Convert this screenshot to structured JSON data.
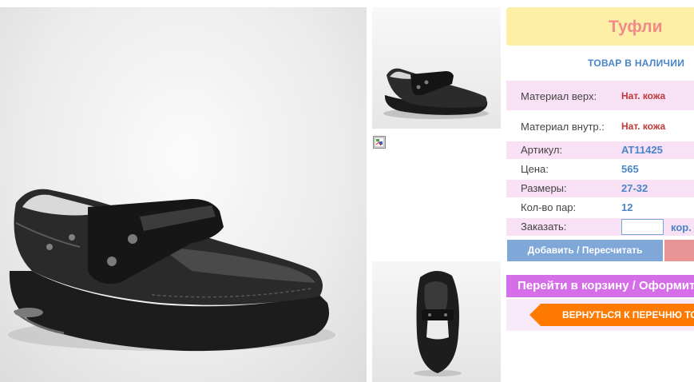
{
  "product": {
    "title": "Туфли",
    "stock_status": "ТОВАР В НАЛИЧИИ"
  },
  "specs": {
    "upper": {
      "label": "Материал верх:",
      "value": "Нат. кожа"
    },
    "lining": {
      "label": "Материал внутр.:",
      "value": "Нат. кожа"
    },
    "article": {
      "label": "Артикул:",
      "value": "AT11425"
    },
    "price": {
      "label": "Цена:",
      "value": "565"
    },
    "sizes": {
      "label": "Размеры:",
      "value": "27-32"
    },
    "pairs": {
      "label": "Кол-во пар:",
      "value": "12"
    }
  },
  "order": {
    "label": "Заказать:",
    "quantity_value": "",
    "unit": "кор."
  },
  "buttons": {
    "add_recalc": "Добавить / Пересчитать",
    "go_cart": "Перейти в корзину / Оформить",
    "back_to_list": "ВЕРНУТЬСЯ К ПЕРЕЧНЮ ТОВАРОВ"
  },
  "colors": {
    "title_bg": "#fdf0a6",
    "title_text": "#f08a8a",
    "accent_blue": "#4a85c8",
    "value_red": "#c0393b",
    "row_pink": "#f8e0f5",
    "cart_purple": "#d56ee8",
    "back_orange": "#ff7a00"
  }
}
